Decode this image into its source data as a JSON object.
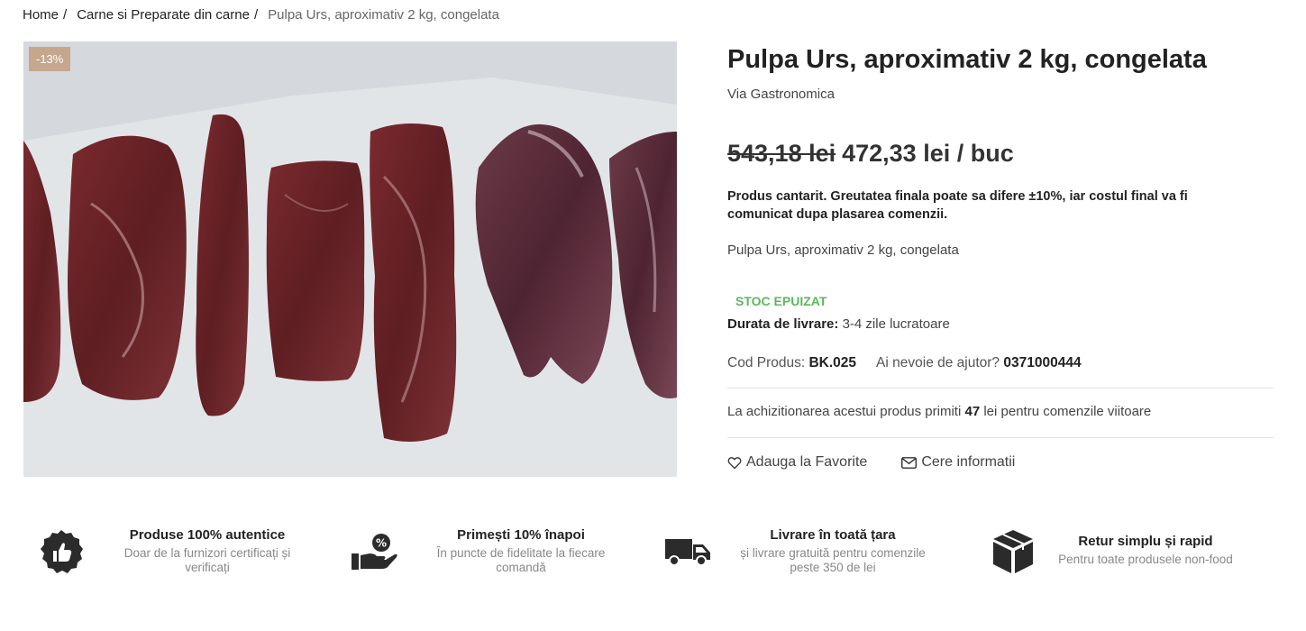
{
  "breadcrumb": {
    "home": "Home",
    "category": "Carne si Preparate din carne",
    "current": "Pulpa Urs, aproximativ 2 kg, congelata"
  },
  "product": {
    "discount_badge": "-13%",
    "title": "Pulpa Urs, aproximativ 2 kg, congelata",
    "brand": "Via Gastronomica",
    "old_price": "543,18 lei",
    "new_price": "472,33 lei / buc",
    "weight_note": "Produs cantarit. Greutatea finala poate sa difere ±10%, iar costul final va fi comunicat dupa plasarea comenzii.",
    "description": "Pulpa Urs, aproximativ 2 kg, congelata",
    "stock_status": "STOC EPUIZAT",
    "delivery_label": "Durata de livrare:",
    "delivery_value": "3-4 zile lucratoare",
    "code_label": "Cod Produs:",
    "code_value": "BK.025",
    "help_label": "Ai nevoie de ajutor?",
    "help_phone": "0371000444",
    "points_prefix": "La achizitionarea acestui produs primiti",
    "points_value": "47",
    "points_suffix": "lei pentru comenzile viitoare",
    "favorite_label": "Adauga la Favorite",
    "info_label": "Cere informatii"
  },
  "features": [
    {
      "icon": "thumbs-up-badge-icon",
      "title": "Produse 100% autentice",
      "sub1": "Doar de la furnizori certificați și",
      "sub2": "verificați"
    },
    {
      "icon": "hand-percent-icon",
      "title": "Primești 10% înapoi",
      "sub1": "În puncte de fidelitate la fiecare",
      "sub2": "comandă"
    },
    {
      "icon": "delivery-truck-icon",
      "title": "Livrare în toată țara",
      "sub1": "și livrare gratuită pentru comenzile",
      "sub2": "peste 350 de lei"
    },
    {
      "icon": "box-icon",
      "title": "Retur simplu și rapid",
      "sub1": "Pentru toate produsele non-food",
      "sub2": ""
    }
  ],
  "colors": {
    "badge": "#c4a78c",
    "stock": "#5cb85c",
    "text": "#222222",
    "muted": "#888888"
  }
}
